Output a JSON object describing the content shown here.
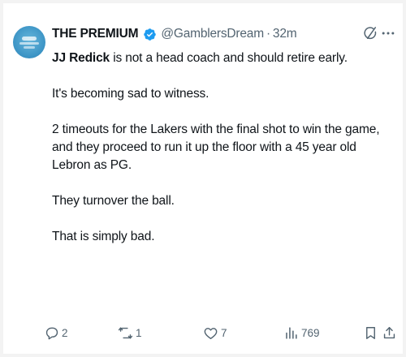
{
  "tweet": {
    "author_name": "THE PREMIUM",
    "handle": "@GamblersDream",
    "separator": "·",
    "time": "32m",
    "mention": "JJ Redick",
    "line1_rest": " is not a head coach and should retire early.",
    "para2": "It's becoming sad to witness.",
    "para3": "2 timeouts for the Lakers with the final shot to win the game, and they proceed to run it up the floor with a 45 year old Lebron as PG.",
    "para4": "They turnover the ball.",
    "para5": "That is simply bad."
  },
  "actions": {
    "replies": "2",
    "reposts": "1",
    "likes": "7",
    "views": "769"
  },
  "colors": {
    "text": "#0f1419",
    "secondary": "#536471",
    "verified": "#1d9bf0",
    "background": "#ffffff"
  },
  "icons": [
    "verified-badge-icon",
    "grok-icon",
    "more-icon",
    "reply-icon",
    "repost-icon",
    "like-icon",
    "views-icon",
    "bookmark-icon",
    "share-icon"
  ]
}
